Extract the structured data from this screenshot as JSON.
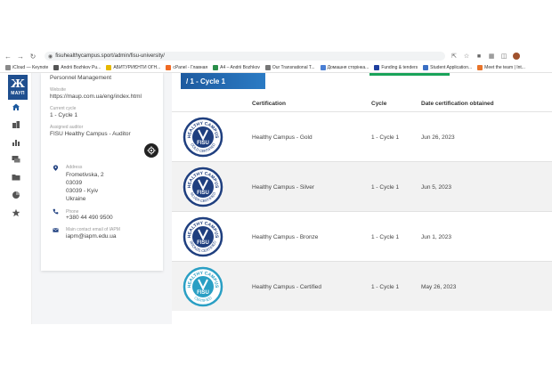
{
  "browser": {
    "url": "fisuhealthycampus.sport/admin/fisu-university/",
    "bookmarks": [
      {
        "label": "iCloud — Keynote",
        "color": "#8a8a8a"
      },
      {
        "label": "Andrii Bozhkov Pu...",
        "color": "#555555"
      },
      {
        "label": "АБИТУРИЄНТИ ОГН...",
        "color": "#e6b800"
      },
      {
        "label": "cPanel - Главная",
        "color": "#f06a24"
      },
      {
        "label": "A4 – Andrii Bozhkov",
        "color": "#2a8f4a"
      },
      {
        "label": "Our Transnational T...",
        "color": "#777777"
      },
      {
        "label": "Домашня сторінка...",
        "color": "#4a7fd4"
      },
      {
        "label": "Funding & tenders",
        "color": "#1f3f9f"
      },
      {
        "label": "Student Application...",
        "color": "#3a6fc4"
      },
      {
        "label": "Meet the team | Int...",
        "color": "#e8742a"
      }
    ]
  },
  "sidebar": {
    "logo_text": "МАУП",
    "items": [
      {
        "name": "home-icon",
        "active": true
      },
      {
        "name": "buildings-icon"
      },
      {
        "name": "bar-chart-icon"
      },
      {
        "name": "chat-icon"
      },
      {
        "name": "folder-icon"
      },
      {
        "name": "pie-chart-icon"
      },
      {
        "name": "star-icon"
      }
    ]
  },
  "university": {
    "name_tail": "Personnel Management",
    "website_label": "Website",
    "website": "https://maup.com.ua/eng/index.html",
    "current_cycle_label": "Current cycle",
    "current_cycle": "1 - Cycle 1",
    "auditor_label": "Assigned auditor",
    "auditor": "FISU Healthy Campus - Auditor",
    "address_label": "Address",
    "address_lines": [
      "Frometivska, 2",
      "03039",
      "03039 - Kyiv",
      "Ukraine"
    ],
    "phone_label": "Phone",
    "phone": "+380 44 490 9500",
    "email_label": "Main contact email of IAPM",
    "email": "iapm@iapm.edu.ua"
  },
  "main": {
    "cycle_banner": "/ 1 - Cycle 1",
    "columns": {
      "certification": "Certification",
      "cycle": "Cycle",
      "date": "Date certification obtained"
    },
    "rows": [
      {
        "certification": "Healthy Campus - Gold",
        "cycle": "1 - Cycle 1",
        "date": "Jun 26, 2023",
        "badge_word": "GOLD CERTIFIED",
        "badge_color": "#1f3f7f"
      },
      {
        "certification": "Healthy Campus - Silver",
        "cycle": "1 - Cycle 1",
        "date": "Jun 5, 2023",
        "badge_word": "SILVER CERTIFIED",
        "badge_color": "#1f3f7f"
      },
      {
        "certification": "Healthy Campus - Bronze",
        "cycle": "1 - Cycle 1",
        "date": "Jun 1, 2023",
        "badge_word": "BRONZE CERTIFIED",
        "badge_color": "#1f3f7f"
      },
      {
        "certification": "Healthy Campus - Certified",
        "cycle": "1 - Cycle 1",
        "date": "May 26, 2023",
        "badge_word": "CERTIFIED",
        "badge_color": "#2a9fc4"
      }
    ],
    "badge_top_text": "HEALTHY CAMPUS",
    "badge_center_text": "FISU"
  },
  "colors": {
    "brand_blue": "#1f4f8f",
    "banner_blue": "#1d5a9f",
    "green_accent": "#19a35a"
  }
}
